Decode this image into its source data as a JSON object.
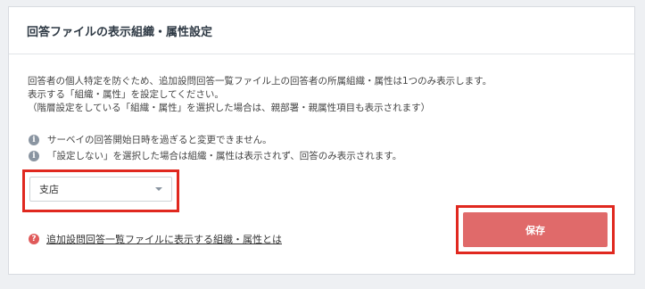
{
  "panel": {
    "title": "回答ファイルの表示組織・属性設定"
  },
  "description": {
    "line1": "回答者の個人特定を防ぐため、追加設問回答一覧ファイル上の回答者の所属組織・属性は1つのみ表示します。",
    "line2": "表示する「組織・属性」を設定してください。",
    "line3": "（階層設定をしている「組織・属性」を選択した場合は、親部署・親属性項目も表示されます）"
  },
  "notes": [
    {
      "icon": "info-icon",
      "text": "サーベイの回答開始日時を過ぎると変更できません。"
    },
    {
      "icon": "info-icon",
      "text": "「設定しない」を選択した場合は組織・属性は表示されず、回答のみ表示されます。"
    }
  ],
  "select": {
    "value": "支店"
  },
  "help": {
    "icon": "question-icon",
    "link_text": "追加設問回答一覧ファイルに表示する組織・属性とは"
  },
  "save_button": {
    "label": "保存"
  },
  "colors": {
    "highlight": "#e0281f",
    "save_bg": "#e06a6a",
    "info_icon": "#8a95a1",
    "help_icon": "#e05a5a"
  }
}
